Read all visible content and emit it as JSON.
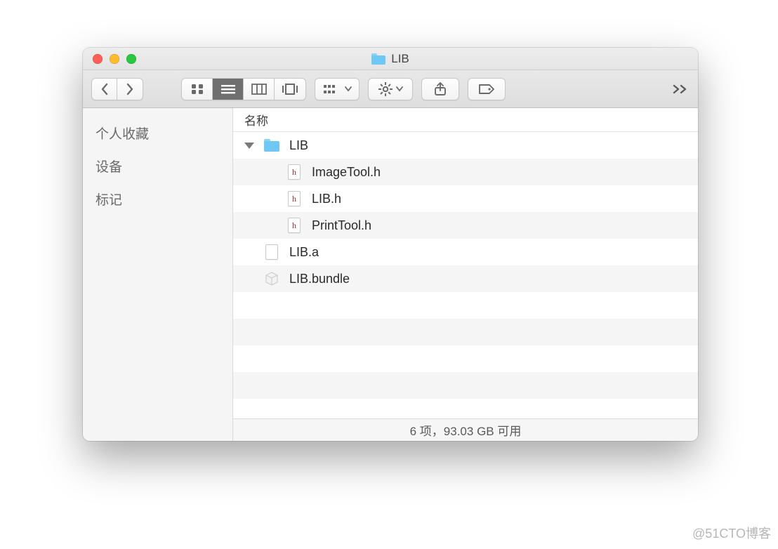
{
  "window": {
    "title": "LIB"
  },
  "sidebar": {
    "items": [
      {
        "label": "个人收藏"
      },
      {
        "label": "设备"
      },
      {
        "label": "标记"
      }
    ]
  },
  "columns": {
    "name": "名称"
  },
  "files": {
    "root": {
      "name": "LIB",
      "children": [
        {
          "name": "ImageTool.h",
          "type": "h"
        },
        {
          "name": "LIB.h",
          "type": "h"
        },
        {
          "name": "PrintTool.h",
          "type": "h"
        }
      ]
    },
    "siblings": [
      {
        "name": "LIB.a",
        "type": "blank"
      },
      {
        "name": "LIB.bundle",
        "type": "bundle"
      }
    ]
  },
  "statusbar": {
    "text": "6 项，93.03 GB 可用"
  },
  "watermark": "@51CTO博客"
}
